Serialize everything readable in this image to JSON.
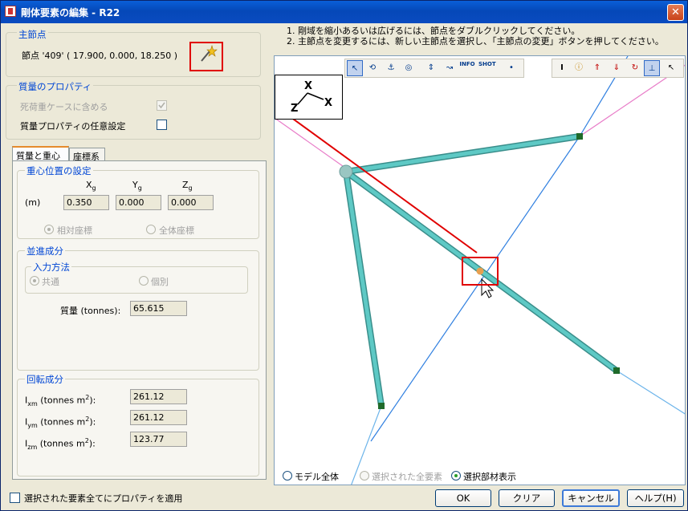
{
  "window": {
    "title": "剛体要素の編集 - R22",
    "close_label": "✕"
  },
  "master_node": {
    "group_label": "主節点",
    "node_text": "節点 '409' ( 17.900, 0.000, 18.250 )"
  },
  "mass_props": {
    "group_label": "質量のプロパティ",
    "include_dead_load_label": "死荷重ケースに含める",
    "include_dead_load_checked": true,
    "custom_mass_label": "質量プロパティの任意設定",
    "custom_mass_checked": false
  },
  "tabs": [
    {
      "label": "質量と重心"
    },
    {
      "label": "座標系"
    }
  ],
  "cog": {
    "group_label": "重心位置の設定",
    "unit": "(m)",
    "headers": [
      "X",
      "Y",
      "Z"
    ],
    "header_sub": "g",
    "values": [
      "0.350",
      "0.000",
      "0.000"
    ],
    "relative_label": "相対座標",
    "global_label": "全体座標"
  },
  "translation": {
    "group_label": "並進成分",
    "input_method_label": "入力方法",
    "common_label": "共通",
    "individual_label": "個別",
    "mass_label": "質量 (tonnes):",
    "mass_value": "65.615"
  },
  "rotation": {
    "group_label": "回転成分",
    "rows": [
      {
        "label_main": "I",
        "label_sub": "xm",
        "label_rest": "(tonnes m",
        "label_sup": "2",
        "label_end": "):",
        "value": "261.12"
      },
      {
        "label_main": "I",
        "label_sub": "ym",
        "label_rest": "(tonnes m",
        "label_sup": "2",
        "label_end": "):",
        "value": "261.12"
      },
      {
        "label_main": "I",
        "label_sub": "zm",
        "label_rest": "(tonnes m",
        "label_sup": "2",
        "label_end": "):",
        "value": "123.77"
      }
    ]
  },
  "hints": [
    "1. 剛域を縮小あるいは広げるには、節点をダブルクリックしてください。",
    "2. 主節点を変更するには、新しい主節点を選択し、「主節点の変更」ボタンを押してください。"
  ],
  "view_options": {
    "model_all": "モデル全体",
    "selected_all": "選択された全要素",
    "selected_members": "選択部材表示"
  },
  "apply_all_label": "選択された要素全てにプロパティを適用",
  "buttons": {
    "ok": "OK",
    "clear": "クリア",
    "cancel": "キャンセル",
    "help": "ヘルプ(H)"
  },
  "axes": {
    "x": "X",
    "z": "Z"
  },
  "toolbar_text": {
    "info": "INFO",
    "shot": "SHOT"
  },
  "colors": {
    "member": "#5ec9c5",
    "highlight": "#e00000",
    "blue_line": "#2f7fe0",
    "pink_line": "#e87cc8"
  }
}
